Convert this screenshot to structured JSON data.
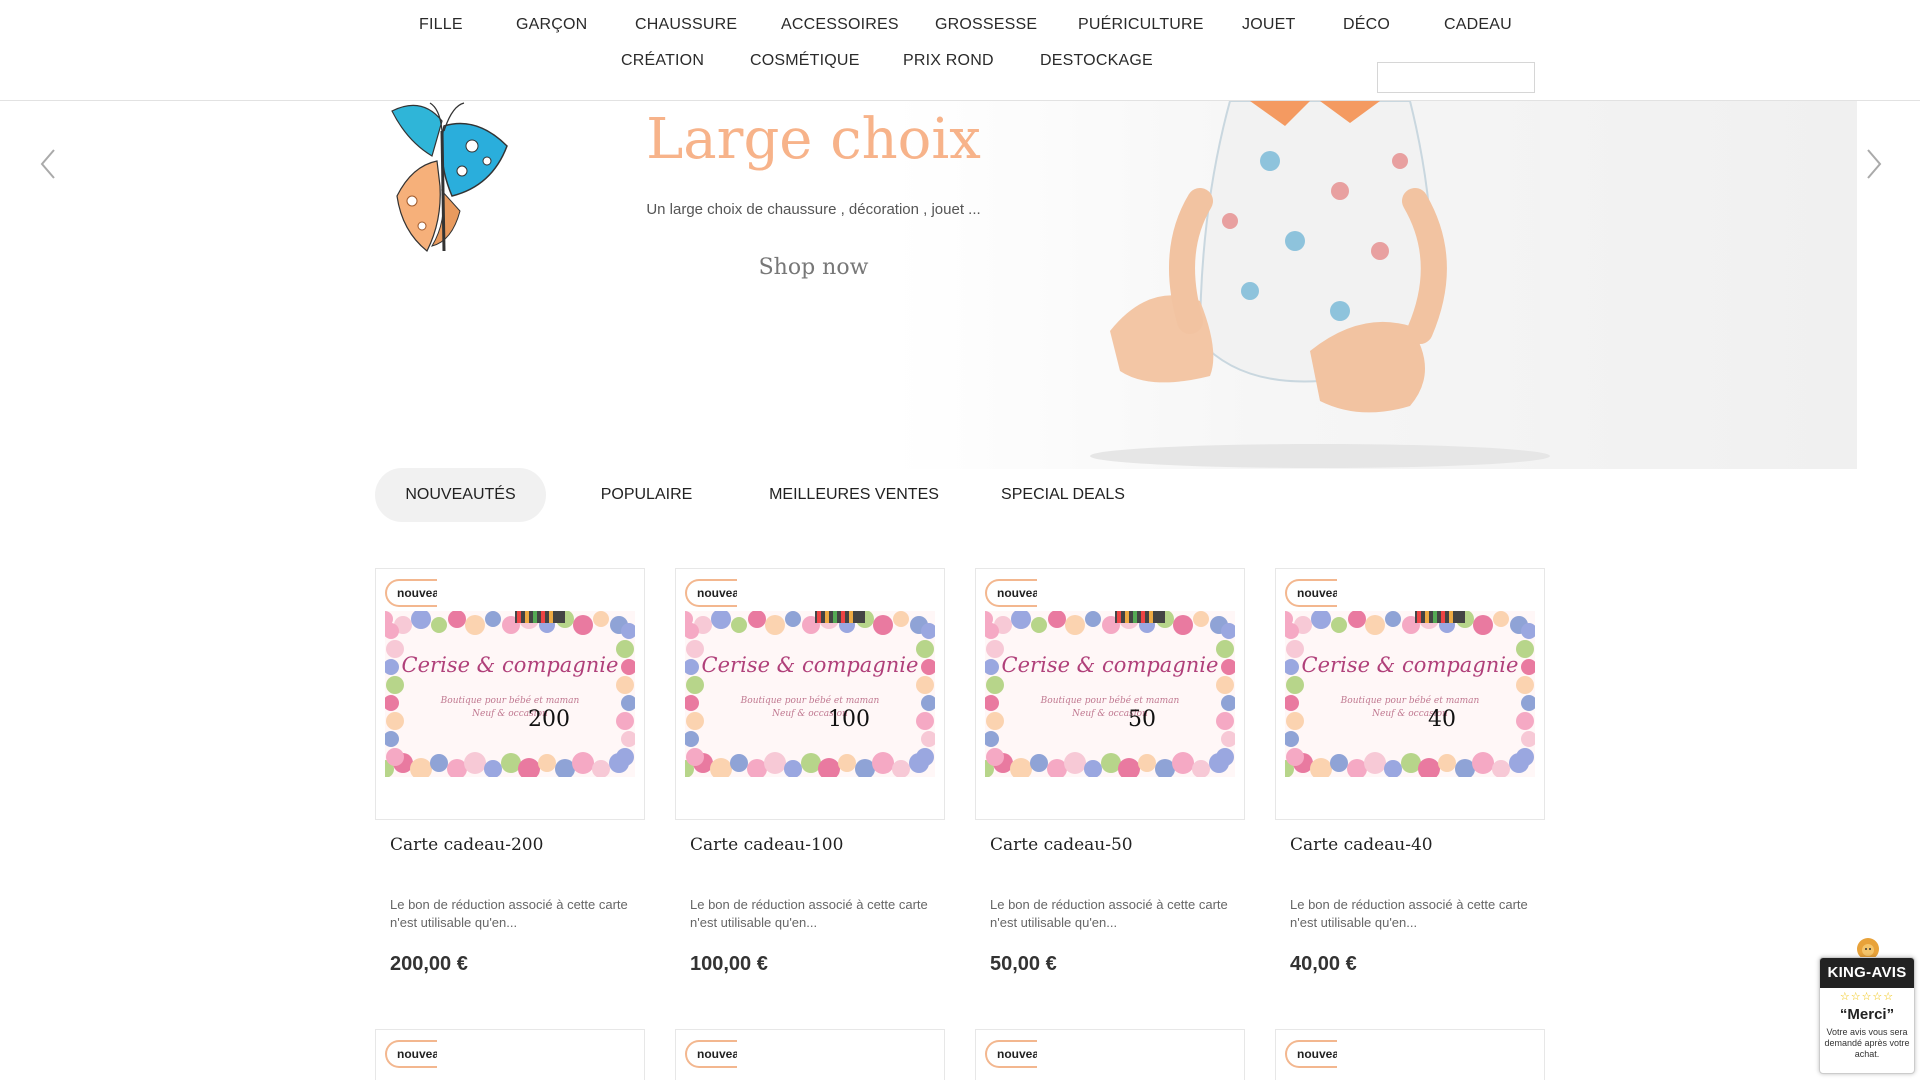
{
  "nav": {
    "row1": [
      "FILLE",
      "GARÇON",
      "CHAUSSURE",
      "ACCESSOIRES",
      "GROSSESSE",
      "PUÉRICULTURE",
      "JOUET",
      "DÉCO",
      "CADEAU"
    ],
    "row2": [
      "CRÉATION",
      "COSMÉTIQUE",
      "PRIX ROND",
      "DESTOCKAGE"
    ],
    "search_placeholder": ""
  },
  "hero": {
    "title": "Large choix",
    "subtitle": "Un large choix de chaussure , décoration , jouet ...",
    "button": "Shop now",
    "prev_icon": "chevron-left-icon",
    "next_icon": "chevron-right-icon"
  },
  "tabs": [
    "NOUVEAUTÉS",
    "POPULAIRE",
    "MEILLEURES VENTES",
    "SPECIAL DEALS"
  ],
  "products": [
    {
      "badge": "nouveau",
      "name": "Carte cadeau-200",
      "amount": "200",
      "description": "Le bon de réduction associé à cette carte n'est utilisable qu'en...",
      "price": "200,00 €"
    },
    {
      "badge": "nouveau",
      "name": "Carte cadeau-100",
      "amount": "100",
      "description": "Le bon de réduction associé à cette carte n'est utilisable qu'en...",
      "price": "100,00 €"
    },
    {
      "badge": "nouveau",
      "name": "Carte cadeau-50",
      "amount": "50",
      "description": "Le bon de réduction associé à cette carte n'est utilisable qu'en...",
      "price": "50,00 €"
    },
    {
      "badge": "nouveau",
      "name": "Carte cadeau-40",
      "amount": "40",
      "description": "Le bon de réduction associé à cette carte n'est utilisable qu'en...",
      "price": "40,00 €"
    }
  ],
  "gift_card": {
    "brand": "Cerise & compagnie",
    "tagline": "Boutique pour bébé et maman",
    "tagline2": "Neuf & occasion"
  },
  "row2_badges": [
    "nouveau",
    "nouveau",
    "nouveau",
    "nouveau"
  ],
  "king_avis": {
    "brand": "KING-AVIS",
    "stars": "☆☆☆☆☆",
    "merci": "“Merci”",
    "text": "Votre avis vous sera demandé après votre achat."
  },
  "colors": {
    "accent": "#f7b38a",
    "badge_border": "#f3b78f",
    "tab_active_bg": "#f1f1f1"
  }
}
